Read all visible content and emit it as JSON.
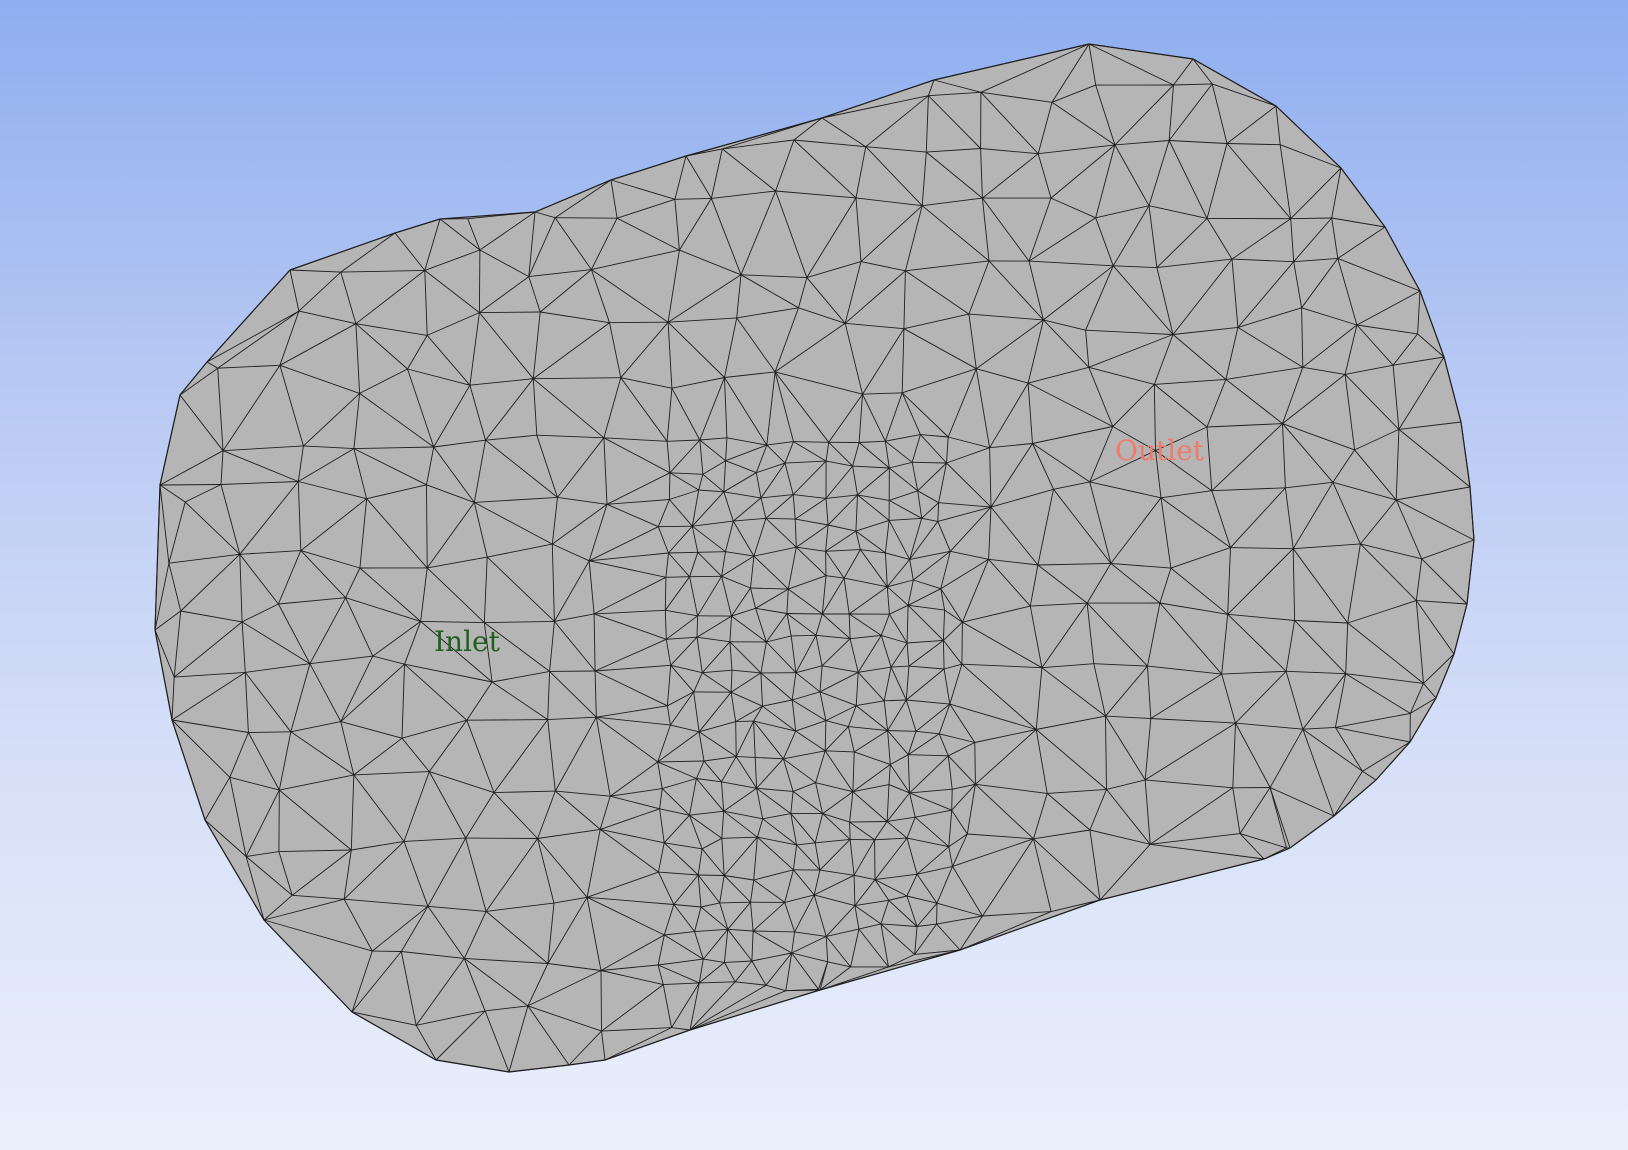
{
  "viewport": {
    "background_top": "#8eaef0",
    "background_bottom": "#eaeffb",
    "mesh_fill": "#b5b5b5",
    "mesh_fill_dark": "#9d9d9d",
    "mesh_edge": "#1e1e1e"
  },
  "labels": {
    "inlet": {
      "text": "Inlet",
      "color": "#1f5f1f"
    },
    "outlet": {
      "text": "Outlet",
      "color": "#f27a6a"
    }
  }
}
